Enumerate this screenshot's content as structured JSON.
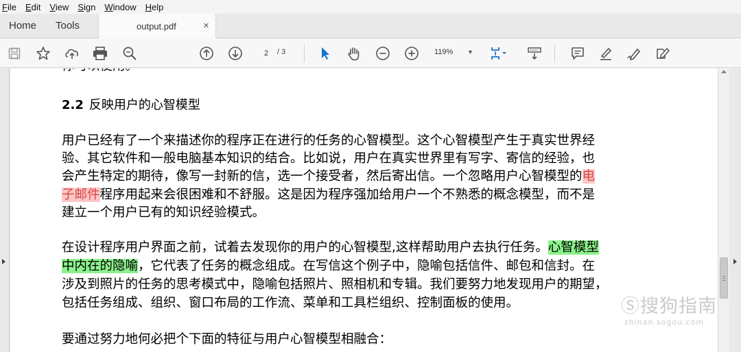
{
  "menu": {
    "items": [
      {
        "key": "F",
        "rest": "ile"
      },
      {
        "key": "E",
        "rest": "dit"
      },
      {
        "key": "V",
        "rest": "iew"
      },
      {
        "key": "S",
        "rest": "ign"
      },
      {
        "key": "W",
        "rest": "indow"
      },
      {
        "key": "H",
        "rest": "elp"
      }
    ]
  },
  "tabs": {
    "home": "Home",
    "tools": "Tools",
    "doc": "output.pdf",
    "close": "×"
  },
  "toolbar": {
    "page_current": "2",
    "page_total": "/ 3",
    "zoom": "119%"
  },
  "document": {
    "top_cut": "你可以使用。",
    "heading_num": "2.2",
    "heading_text": "反映用户的心智模型",
    "p1": {
      "l1": "用户已经有了一个来描述你的程序正在进行的任务的心智模型。这个心智模型产生于真实世界经",
      "l2": "验、其它软件和一般电脑基本知识的结合。比如说，用户在真实世界里有写字、寄信的经验，也",
      "l3_a": "会产生特定的期待，像写一封新的信，选一个接受者，然后寄出信。一个忽略用户心智模型的",
      "l3_hl": "电",
      "l4_hl": "子邮件",
      "l4_b": "程序用起来会很困难和不舒服。这是因为程序强加给用户一个不熟悉的概念模型，而不是",
      "l5": "建立一个用户已有的知识经验模式。"
    },
    "p2": {
      "l1_a": "在设计程序用户界面之前，试着去发现你的用户的心智模型,这样帮助用户去执行任务。",
      "l1_hl": "心智模型",
      "l2_hl": "中内在的隐喻",
      "l2_b": "，它代表了任务的概念组成。在写信这个例子中，隐喻包括信件、邮包和信封。在",
      "l3": "涉及到照片的任务的思考模式中，隐喻包括照片、照相机和专辑。我们要努力地发现用户的期望，",
      "l4": "包括任务组成、组织、窗口布局的工作流、菜单和工具栏组织、控制面板的使用。"
    },
    "p3": "要通过努力地何必把个下面的特征与用户心智模型相融合："
  },
  "watermark": {
    "main": "Ⓢ搜狗指南",
    "sub": "zhinan.sogou.com"
  },
  "colors": {
    "highlight_red_bg": "#fcc6c6",
    "highlight_red_text": "#d84848",
    "highlight_green_bg": "#8cf28c",
    "toolbar_icon": "#555555",
    "accent_blue": "#1a73c8"
  }
}
